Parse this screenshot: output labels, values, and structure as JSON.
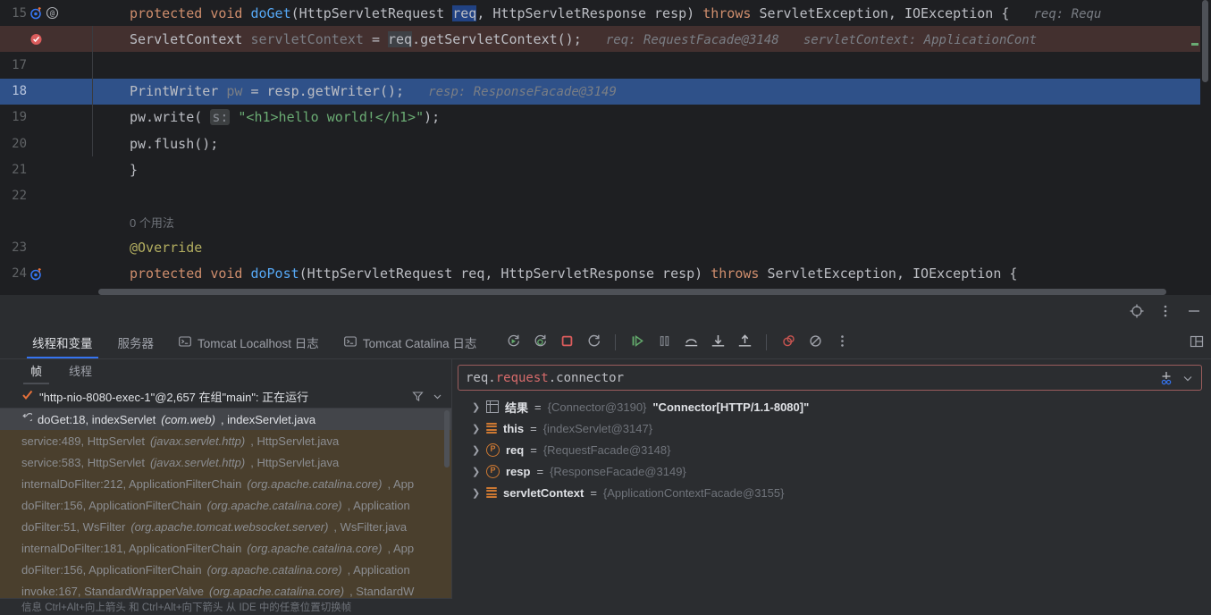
{
  "editor": {
    "lines": [
      {
        "num": "15",
        "gutter": [
          "override-method-icon",
          "annotation-icon"
        ],
        "state": "normal",
        "indent": 0,
        "segments": [
          {
            "t": "protected ",
            "c": "kw"
          },
          {
            "t": "void ",
            "c": "kw"
          },
          {
            "t": "doGet",
            "c": "meth"
          },
          {
            "t": "(HttpServletRequest ",
            "c": "pln"
          },
          {
            "t": "req",
            "c": "sel"
          },
          {
            "t": ", HttpServletResponse resp) ",
            "c": "pln"
          },
          {
            "t": "throws ",
            "c": "kw"
          },
          {
            "t": "ServletException, IOException {",
            "c": "pln"
          }
        ],
        "hints": [
          {
            "label": "req:",
            "value": "Requ"
          }
        ]
      },
      {
        "num": "",
        "gutter": [
          "breakpoint-icon"
        ],
        "state": "breakpoint",
        "indent": 1,
        "segments": [
          {
            "t": "ServletContext ",
            "c": "typ"
          },
          {
            "t": "servletContext ",
            "c": "gray"
          },
          {
            "t": "= ",
            "c": "pln"
          },
          {
            "t": "req",
            "c": "ident-hl"
          },
          {
            "t": ".getServletContext();",
            "c": "pln"
          }
        ],
        "hints": [
          {
            "label": "req:",
            "value": "RequestFacade@3148"
          },
          {
            "label": "servletContext:",
            "value": "ApplicationCont"
          }
        ]
      },
      {
        "num": "17",
        "gutter": [],
        "state": "normal",
        "indent": 1,
        "segments": [],
        "hints": []
      },
      {
        "num": "18",
        "gutter": [],
        "state": "execution",
        "indent": 1,
        "segments": [
          {
            "t": "PrintWriter ",
            "c": "typ"
          },
          {
            "t": "pw ",
            "c": "gray"
          },
          {
            "t": "= resp.getWriter();",
            "c": "pln"
          }
        ],
        "hints": [
          {
            "label": "resp:",
            "value": "ResponseFacade@3149"
          }
        ]
      },
      {
        "num": "19",
        "gutter": [],
        "state": "normal",
        "indent": 1,
        "segments": [
          {
            "t": "pw.write( ",
            "c": "pln"
          },
          {
            "t": "s:",
            "c": "param-hint"
          },
          {
            "t": " ",
            "c": "pln"
          },
          {
            "t": "\"<h1>hello world!</h1>\"",
            "c": "str"
          },
          {
            "t": ");",
            "c": "pln"
          }
        ],
        "hints": []
      },
      {
        "num": "20",
        "gutter": [],
        "state": "normal",
        "indent": 1,
        "segments": [
          {
            "t": "pw.flush();",
            "c": "pln"
          }
        ],
        "hints": []
      },
      {
        "num": "21",
        "gutter": [],
        "state": "normal",
        "indent": 0,
        "segments": [
          {
            "t": "}",
            "c": "pln"
          }
        ],
        "hints": []
      },
      {
        "num": "22",
        "gutter": [],
        "state": "normal",
        "indent": 0,
        "segments": [],
        "hints": []
      },
      {
        "num": "",
        "gutter": [],
        "state": "normal",
        "indent": 0,
        "usage_hint": "0 个用法",
        "segments": [],
        "hints": []
      },
      {
        "num": "23",
        "gutter": [],
        "state": "normal",
        "indent": 0,
        "segments": [
          {
            "t": "@Override",
            "c": "ann"
          }
        ],
        "hints": []
      },
      {
        "num": "24",
        "gutter": [
          "override-method-icon"
        ],
        "state": "normal",
        "indent": 0,
        "segments": [
          {
            "t": "protected ",
            "c": "kw"
          },
          {
            "t": "void ",
            "c": "kw"
          },
          {
            "t": "doPost",
            "c": "meth"
          },
          {
            "t": "(HttpServletRequest req, HttpServletResponse resp) ",
            "c": "pln"
          },
          {
            "t": "throws ",
            "c": "kw"
          },
          {
            "t": "ServletException, IOException {",
            "c": "pln"
          }
        ],
        "hints": []
      }
    ]
  },
  "debug": {
    "header_icons": [
      "target-icon",
      "more-vertical-icon",
      "minimize-icon"
    ],
    "tabs": [
      {
        "label": "线程和变量",
        "icon": null,
        "active": true
      },
      {
        "label": "服务器",
        "icon": null,
        "active": false
      },
      {
        "label": "Tomcat Localhost 日志",
        "icon": "console-icon",
        "active": false
      },
      {
        "label": "Tomcat Catalina 日志",
        "icon": "console-icon",
        "active": false
      }
    ],
    "toolbar": [
      {
        "name": "rerun-button",
        "icon": "rerun-icon"
      },
      {
        "name": "rerun-debug-button",
        "icon": "rerun-debug-icon"
      },
      {
        "name": "stop-button",
        "icon": "stop-icon"
      },
      {
        "name": "restart-button",
        "icon": "restart-icon"
      },
      {
        "name": "resume-button",
        "icon": "resume-icon"
      },
      {
        "name": "pause-button",
        "icon": "pause-icon"
      },
      {
        "name": "step-over-button",
        "icon": "step-over-icon"
      },
      {
        "name": "step-into-button",
        "icon": "step-into-icon"
      },
      {
        "name": "step-out-button",
        "icon": "step-out-icon"
      },
      {
        "name": "mute-breakpoints-button",
        "icon": "mute-breakpoints-icon"
      },
      {
        "name": "view-breakpoints-button",
        "icon": "view-breakpoints-icon"
      },
      {
        "name": "more-options-button",
        "icon": "more-vertical-icon"
      }
    ],
    "layout_toggle": "layout-settings-icon",
    "frames_panel": {
      "sub_tabs": [
        {
          "label": "帧",
          "active": true
        },
        {
          "label": "线程",
          "active": false
        }
      ],
      "thread": "\"http-nio-8080-exec-1\"@2,657 在组\"main\": 正在运行",
      "thread_icons": [
        "filter-icon",
        "chevron-down-icon"
      ],
      "frames": [
        {
          "text": "doGet:18, indexServlet",
          "pkg": "(com.web)",
          "file": ", indexServlet.java",
          "type": "current"
        },
        {
          "text": "service:489, HttpServlet",
          "pkg": "(javax.servlet.http)",
          "file": ", HttpServlet.java",
          "type": "library"
        },
        {
          "text": "service:583, HttpServlet",
          "pkg": "(javax.servlet.http)",
          "file": ", HttpServlet.java",
          "type": "library"
        },
        {
          "text": "internalDoFilter:212, ApplicationFilterChain",
          "pkg": "(org.apache.catalina.core)",
          "file": ", App",
          "type": "library"
        },
        {
          "text": "doFilter:156, ApplicationFilterChain",
          "pkg": "(org.apache.catalina.core)",
          "file": ", Application",
          "type": "library"
        },
        {
          "text": "doFilter:51, WsFilter",
          "pkg": "(org.apache.tomcat.websocket.server)",
          "file": ", WsFilter.java",
          "type": "library"
        },
        {
          "text": "internalDoFilter:181, ApplicationFilterChain",
          "pkg": "(org.apache.catalina.core)",
          "file": ", App",
          "type": "library"
        },
        {
          "text": "doFilter:156, ApplicationFilterChain",
          "pkg": "(org.apache.catalina.core)",
          "file": ", Application",
          "type": "library"
        },
        {
          "text": "invoke:167, StandardWrapperValve",
          "pkg": "(org.apache.catalina.core)",
          "file": ", StandardW",
          "type": "library"
        }
      ],
      "status_hint": "信息 Ctrl+Alt+向上箭头 和 Ctrl+Alt+向下箭头 从 IDE 中的任意位置切换帧"
    },
    "variables_panel": {
      "evaluate": {
        "prefix": "req.",
        "highlight": "request",
        "suffix": ".connector",
        "icons": [
          "add-to-watches-icon",
          "chevron-down-icon"
        ]
      },
      "variables": [
        {
          "icon": "result-grid-icon",
          "name": "结果",
          "value": "{Connector@3190}",
          "string": "\"Connector[HTTP/1.1-8080]\""
        },
        {
          "icon": "object-icon",
          "name": "this",
          "value": "{indexServlet@3147}",
          "string": ""
        },
        {
          "icon": "param-icon",
          "name": "req",
          "value": "{RequestFacade@3148}",
          "string": ""
        },
        {
          "icon": "param-icon",
          "name": "resp",
          "value": "{ResponseFacade@3149}",
          "string": ""
        },
        {
          "icon": "object-icon",
          "name": "servletContext",
          "value": "{ApplicationContextFacade@3155}",
          "string": ""
        }
      ]
    }
  }
}
